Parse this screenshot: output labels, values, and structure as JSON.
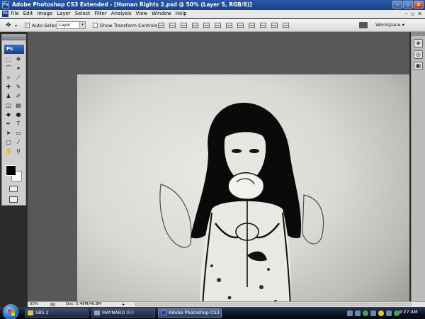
{
  "window": {
    "title": "Adobe Photoshop CS3 Extended - [Human Rights 2.psd @ 50% (Layer 5, RGB/8)]",
    "app_icon": "Ps",
    "controls": [
      "minimize-icon",
      "maximize-icon",
      "close-icon"
    ]
  },
  "menu": {
    "items": [
      "File",
      "Edit",
      "Image",
      "Layer",
      "Select",
      "Filter",
      "Analysis",
      "View",
      "Window",
      "Help"
    ]
  },
  "options": {
    "auto_select_label": "Auto-Select:",
    "auto_select_checked": true,
    "auto_select_value": "Layer",
    "show_transform_label": "Show Transform Controls",
    "show_transform_checked": false,
    "workspace_label": "Workspace ▾"
  },
  "toolbox": {
    "logo": "Ps",
    "tools": [
      "marquee-icon",
      "move-icon",
      "lasso-icon",
      "magic-wand-icon",
      "crop-icon",
      "slice-icon",
      "healing-brush-icon",
      "brush-icon",
      "clone-stamp-icon",
      "history-brush-icon",
      "eraser-icon",
      "gradient-icon",
      "blur-icon",
      "dodge-icon",
      "pen-icon",
      "type-icon",
      "path-select-icon",
      "shape-icon",
      "notes-icon",
      "eyedropper-icon",
      "hand-icon",
      "zoom-icon"
    ],
    "tool_glyphs": [
      "⬚",
      "✥",
      "⌒",
      "✦",
      "⌗",
      "⟋",
      "✚",
      "✎",
      "♟",
      "✐",
      "◫",
      "▤",
      "◆",
      "●",
      "✒",
      "T",
      "➤",
      "▭",
      "▢",
      "⁄",
      "✋",
      "⚲"
    ],
    "foreground_color": "#000000",
    "background_color": "#ffffff"
  },
  "document": {
    "name": "Human Rights 2.psd",
    "zoom": "50%",
    "layer": "Layer 5",
    "mode": "RGB/8"
  },
  "status": {
    "zoom": "50%",
    "doc_info": "Doc: 5.49M/46.8M"
  },
  "taskbar": {
    "tasks": [
      {
        "label": "SBS 2",
        "icon": "folder-icon",
        "active": false
      },
      {
        "label": "MAYNARD (F:)",
        "icon": "drive-icon",
        "active": false
      },
      {
        "label": "Adobe Photoshop CS3...",
        "icon": "photoshop-icon",
        "active": true
      }
    ],
    "clock": "9:27 AM"
  }
}
